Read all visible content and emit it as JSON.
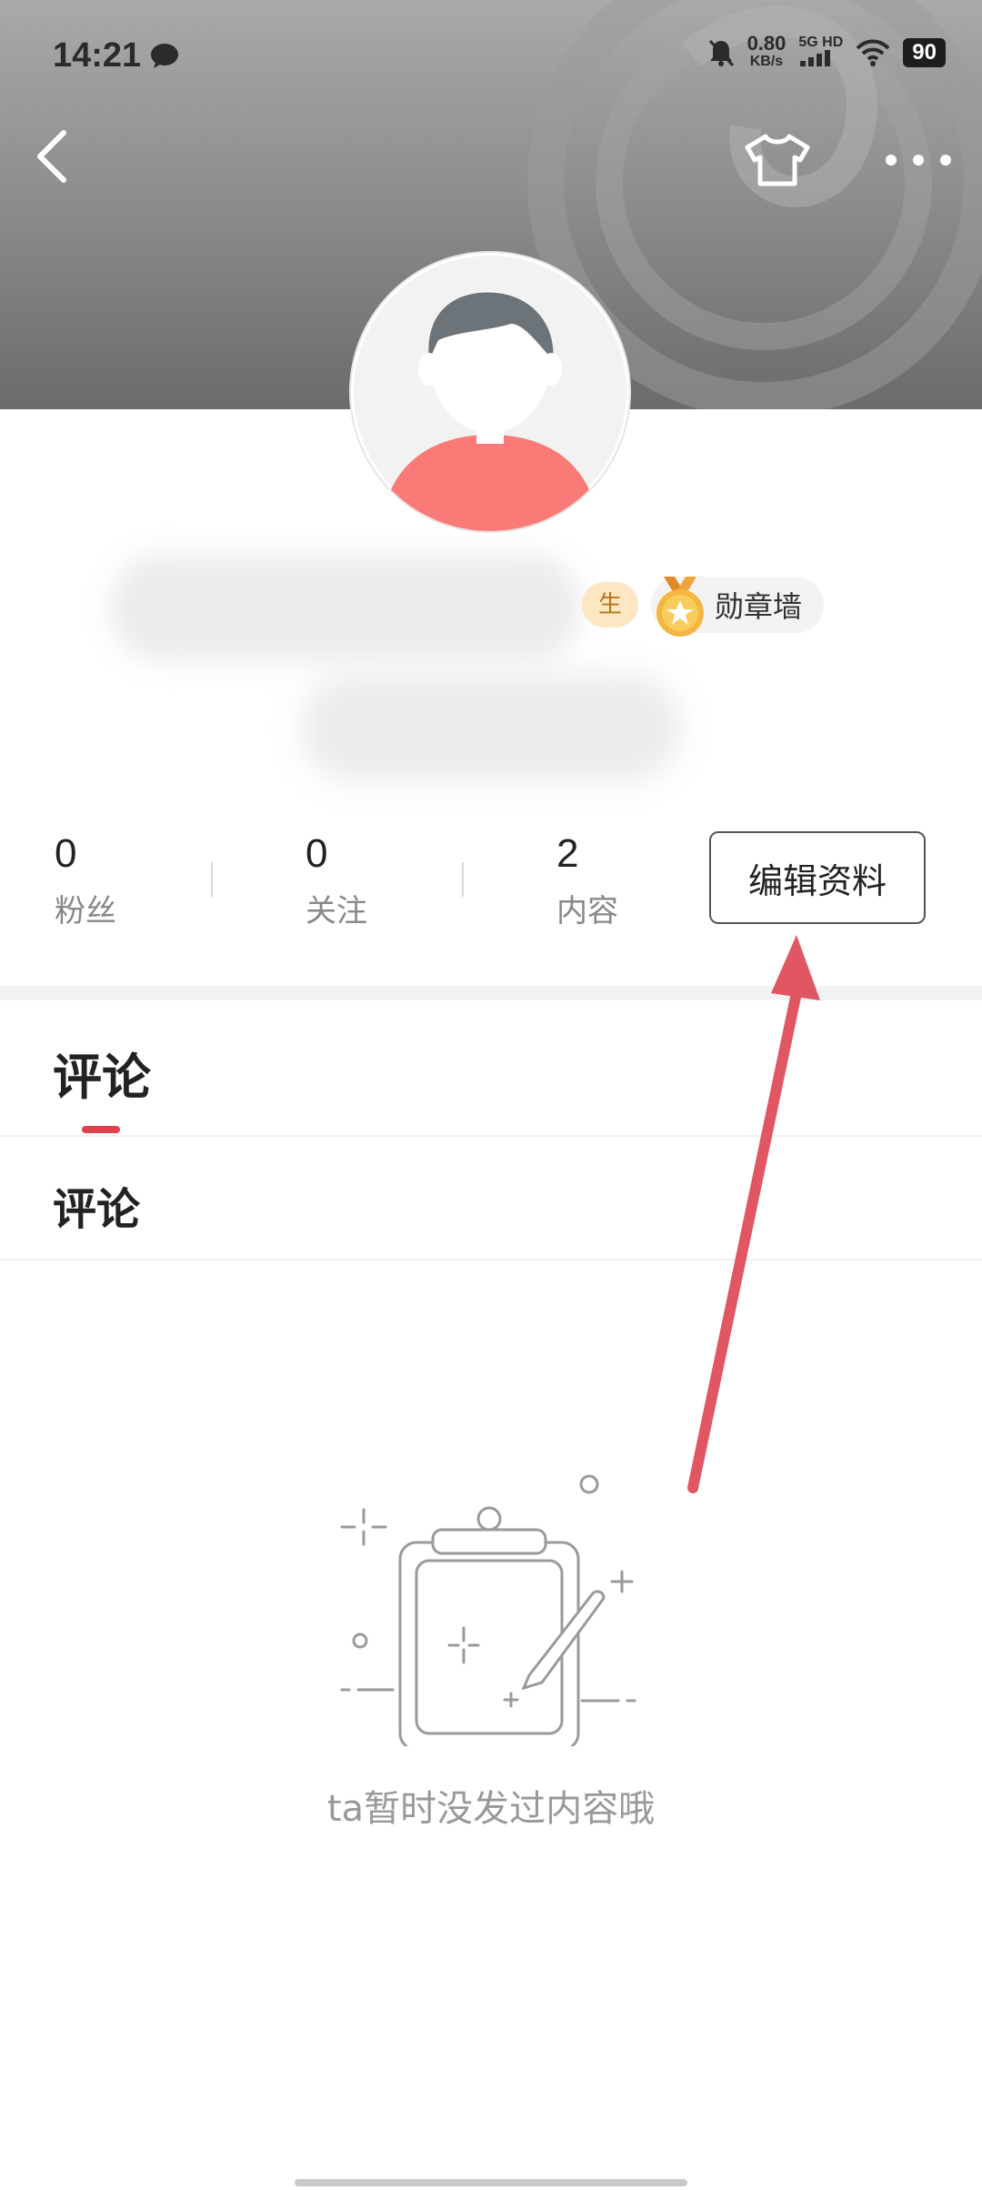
{
  "status_bar": {
    "time": "14:21",
    "net_speed_value": "0.80",
    "net_speed_unit": "KB/s",
    "network_type": "5G HD",
    "battery": "90",
    "icons": [
      "message-bubble-icon",
      "mute-bell-icon",
      "signal-icon",
      "wifi-icon",
      "battery-icon"
    ]
  },
  "header": {
    "back_icon": "chevron-left-icon",
    "skin_icon": "tshirt-icon",
    "more_icon": "more-dots-icon"
  },
  "profile": {
    "badge_partial": "生",
    "medal_wall_label": "勋章墙"
  },
  "stats": [
    {
      "value": "0",
      "label": "粉丝"
    },
    {
      "value": "0",
      "label": "关注"
    },
    {
      "value": "2",
      "label": "内容"
    }
  ],
  "edit_button_label": "编辑资料",
  "tabs": {
    "active_tab": "评论",
    "section_title": "评论"
  },
  "empty_state": {
    "message": "ta暂时没发过内容哦"
  },
  "colors": {
    "accent_red": "#e2414b",
    "arrow_color": "#e05663"
  }
}
